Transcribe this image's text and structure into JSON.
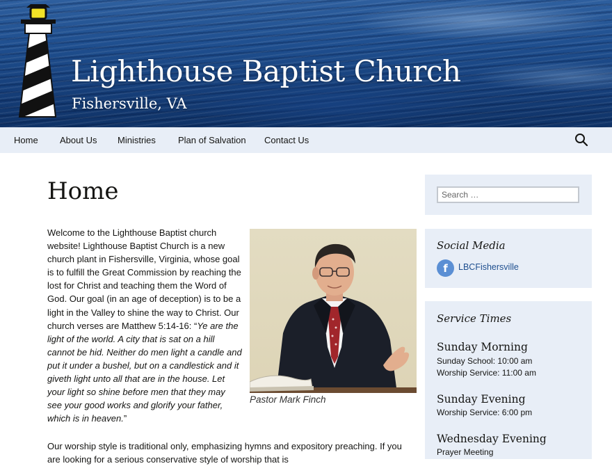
{
  "site": {
    "title": "Lighthouse Baptist Church",
    "subtitle": "Fishersville, VA"
  },
  "nav": {
    "items": [
      "Home",
      "About Us",
      "Ministries",
      "Plan of Salvation",
      "Contact Us"
    ],
    "search_icon": "search-icon"
  },
  "page": {
    "title": "Home",
    "intro_plain": "Welcome to the Lighthouse Baptist church website! Lighthouse Baptist Church is a new church plant in Fishersville, Virginia, whose goal is to fulfill the Great Commission by reaching the lost for Christ and teaching them the Word of God. Our goal (in an age of deception) is to be a light in the Valley to shine the way to Christ. Our church verses are Matthew 5:14-16: “",
    "intro_quote": "Ye are the light of the world. A city that is sat on a hill cannot be hid. Neither do men light a candle and put it under a bushel, but on a candlestick and it giveth light unto all that are in the house. Let your light so shine before men that they may see your good works and glorify your father, which is in heaven.",
    "intro_end": "”",
    "worship_text": "Our worship style is traditional only, emphasizing hymns and expository preaching. If you are looking for a serious conservative style of worship that is",
    "photo_caption": "Pastor Mark Finch"
  },
  "sidebar": {
    "search": {
      "placeholder": "Search …"
    },
    "social": {
      "title": "Social Media",
      "facebook_icon": "facebook-icon",
      "facebook_glyph": "f",
      "facebook_label": "LBCFishersville",
      "accent": "#5b8fd4"
    },
    "service_times": {
      "title": "Service Times",
      "sunday_morning": {
        "heading": "Sunday Morning",
        "lines": [
          "Sunday School: 10:00 am",
          "Worship Service: 11:00 am"
        ]
      },
      "sunday_evening": {
        "heading": "Sunday Evening",
        "lines": [
          "Worship Service: 6:00 pm"
        ]
      },
      "wednesday_evening": {
        "heading": "Wednesday Evening",
        "lines": [
          "Prayer Meeting"
        ]
      }
    }
  },
  "colors": {
    "nav_bg": "#e8eef7",
    "sidebar_bg": "#e8eef7",
    "link": "#1f4f8f"
  }
}
